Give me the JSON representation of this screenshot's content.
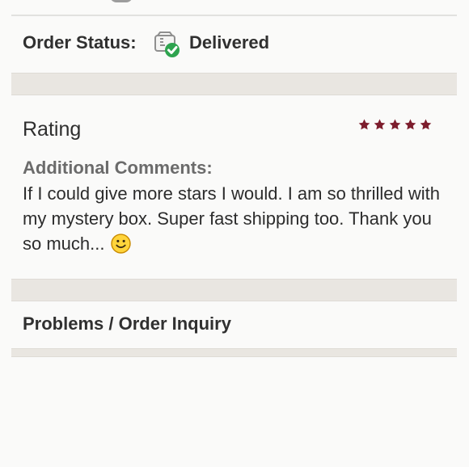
{
  "order_status": {
    "label": "Order Status:",
    "value": "Delivered",
    "icon": "delivered-box-icon",
    "check_color": "#2ea44f"
  },
  "rating": {
    "title": "Rating",
    "stars": 5,
    "max_stars": 5,
    "star_color": "#7d1d2d"
  },
  "comments": {
    "label": "Additional Comments:",
    "text": "If I could give more stars I would. I am so thrilled with my mystery box. Super fast shipping too. Thank you so much...",
    "emoji": "smiling-face-icon"
  },
  "problems": {
    "label": "Problems / Order Inquiry"
  }
}
